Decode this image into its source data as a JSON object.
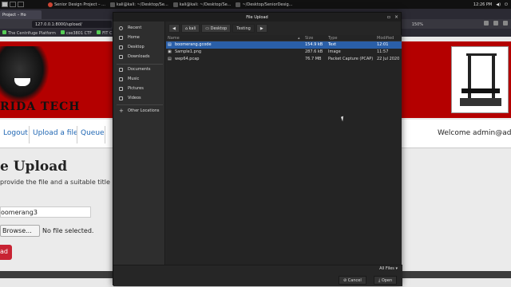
{
  "taskbar": {
    "tasks": [
      "Senior Design Project – ...",
      "kali@kali: ~/Desktop/Se...",
      "kali@kali: ~/Desktop/Se...",
      "~/Desktop/SeniorDesig..."
    ],
    "clock": "12:26 PM"
  },
  "browser": {
    "tab_title": "Project – Ho",
    "url": "127.0.0.1:8000/upload/",
    "zoom": "150%",
    "bookmarks": [
      "The Centrifuge Platform",
      "cse3801 CTF",
      "FIT C"
    ]
  },
  "page": {
    "brand": "RIDA TECH",
    "nav": [
      "Logout",
      "Upload a file",
      "Queue"
    ],
    "welcome": "Welcome admin@adm",
    "heading": "e Upload",
    "subtitle": " provide the file and a suitable title",
    "name_value": "oomerang3",
    "browse_label": "Browse...",
    "no_file": "No file selected.",
    "upload_label": "ad"
  },
  "dialog": {
    "title": "File Upload",
    "sidebar": [
      "Recent",
      "Home",
      "Desktop",
      "Downloads",
      "Documents",
      "Music",
      "Pictures",
      "Videos",
      "Other Locations"
    ],
    "path": [
      "kali",
      "Desktop",
      "Testing"
    ],
    "columns": {
      "name": "Name",
      "size": "Size",
      "type": "Type",
      "modified": "Modified"
    },
    "files": [
      {
        "name": "boomerang.gcode",
        "size": "154.9 kB",
        "type": "Text",
        "modified": "12:01"
      },
      {
        "name": "Sample1.png",
        "size": "287.6 kB",
        "type": "Image",
        "modified": "11:57"
      },
      {
        "name": "wep64.pcap",
        "size": "76.7 MB",
        "type": "Packet Capture (PCAP)",
        "modified": "22 Jul 2020"
      }
    ],
    "filter": "All Files ▾",
    "cancel": "Cancel",
    "open": "Open"
  }
}
